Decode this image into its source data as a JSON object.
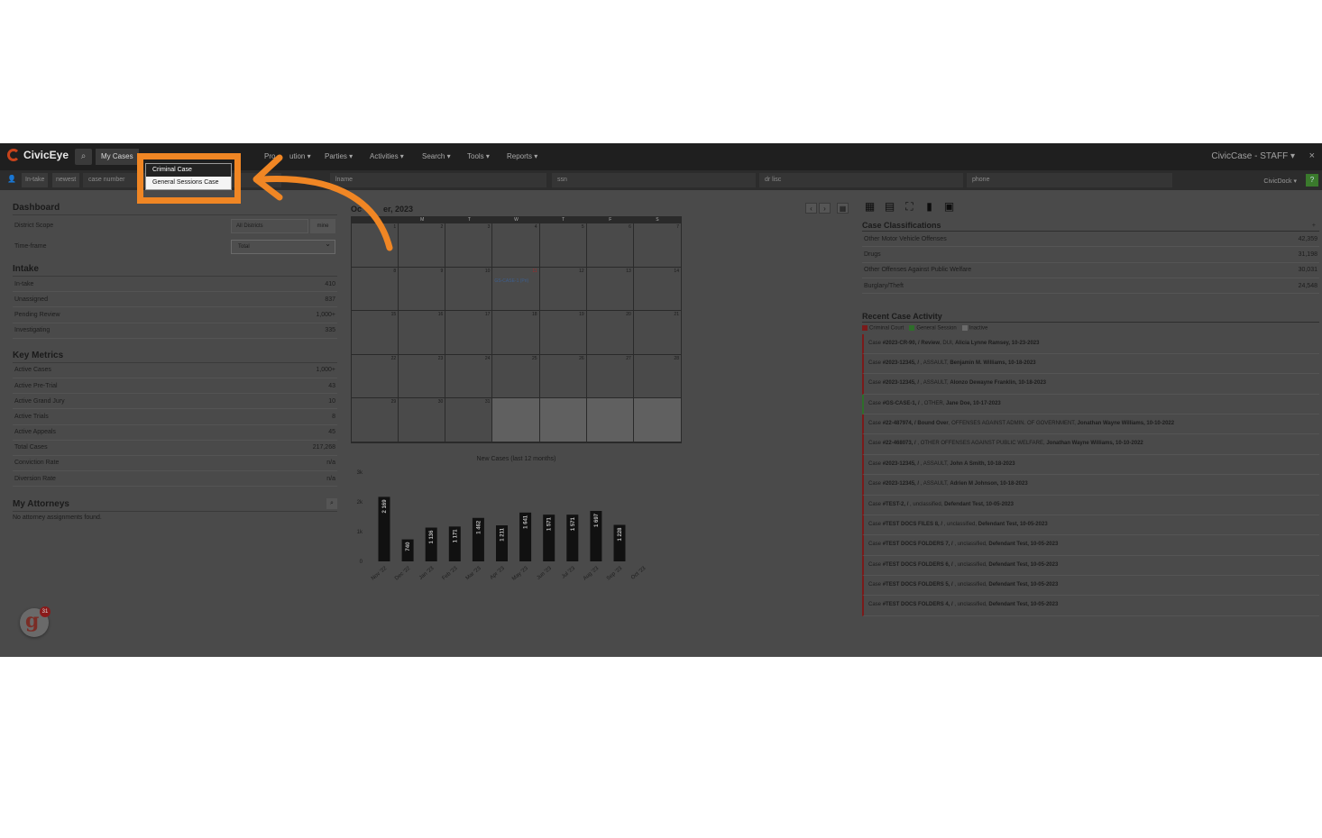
{
  "app": {
    "name": "CivicEye",
    "brand_right": "CivicCase - STAFF",
    "close": "×"
  },
  "nav": {
    "search_icon": "search-icon",
    "my_cases": "My Cases",
    "prosecution_visible": "Pro",
    "prosecution_tail": "ution",
    "items": [
      "Parties",
      "Activities",
      "Search",
      "Tools",
      "Reports"
    ]
  },
  "subbar": {
    "intake": "In-take",
    "newest": "newest",
    "case_number_ph": "case number",
    "lname_ph": "lname",
    "ssn_ph": "ssn",
    "dl_ph": "dr lisc",
    "phone_ph": "phone",
    "civicdock": "CivicDock",
    "green_btn": "?"
  },
  "dropdown": {
    "items": [
      "Criminal Case",
      "General Sessions Case"
    ]
  },
  "dashboard": {
    "title": "Dashboard",
    "district_label": "District Scope",
    "district_value": "All Districts",
    "mine": "mine",
    "timeframe_label": "Time-frame",
    "timeframe_value": "Total"
  },
  "intake": {
    "title": "Intake",
    "rows": [
      {
        "label": "In-take",
        "value": "410"
      },
      {
        "label": "Unassigned",
        "value": "837"
      },
      {
        "label": "Pending Review",
        "value": "1,000+"
      },
      {
        "label": "Investigating",
        "value": "335"
      }
    ]
  },
  "metrics": {
    "title": "Key Metrics",
    "rows": [
      {
        "label": "Active Cases",
        "value": "1,000+"
      },
      {
        "label": "Active Pre-Trial",
        "value": "43"
      },
      {
        "label": "Active Grand Jury",
        "value": "10"
      },
      {
        "label": "Active Trials",
        "value": "8"
      },
      {
        "label": "Active Appeals",
        "value": "45"
      },
      {
        "label": "Total Cases",
        "value": "217,268"
      },
      {
        "label": "Conviction Rate",
        "value": "n/a"
      },
      {
        "label": "Diversion Rate",
        "value": "n/a"
      }
    ]
  },
  "attorneys": {
    "title": "My Attorneys",
    "empty": "No attorney assignments found."
  },
  "calendar": {
    "title_start": "Oc",
    "title_end": "er, 2023",
    "days": [
      "S",
      "M",
      "T",
      "W",
      "T",
      "F",
      "S"
    ],
    "event": "GS-CASE-1 (Pri)",
    "prev": "‹",
    "next": "›",
    "cal_icon": "▦"
  },
  "chart_data": {
    "type": "bar",
    "title": "New Cases (last 12 months)",
    "categories": [
      "Nov '22",
      "Dec '22",
      "Jan '23",
      "Feb '23",
      "Mar '23",
      "Apr '23",
      "May '23",
      "Jun '23",
      "Jul '23",
      "Aug '23",
      "Sep '23",
      "Oct '23"
    ],
    "values": [
      2169,
      740,
      1136,
      1171,
      1462,
      1211,
      1641,
      1571,
      1571,
      1697,
      1228,
      0
    ],
    "value_labels": [
      "2 169",
      "740",
      "1 136",
      "1 171",
      "1 462",
      "1 211",
      "1 641",
      "1 571",
      "1 571",
      "1 697",
      "1 228",
      ""
    ],
    "yticks": [
      "0",
      "1k",
      "2k",
      "3k"
    ],
    "ylim": [
      0,
      3000
    ],
    "grid": false
  },
  "right": {
    "tool_icons": [
      "calculator-icon",
      "calendar-icon",
      "org-chart-icon",
      "document-icon",
      "book-icon"
    ],
    "classifications_title": "Case Classifications",
    "plus": "+",
    "classifications": [
      {
        "label": "Other Motor Vehicle Offenses",
        "value": "42,359"
      },
      {
        "label": "Drugs",
        "value": "31,198"
      },
      {
        "label": "Other Offenses Against Public Welfare",
        "value": "30,031"
      },
      {
        "label": "Burglary/Theft",
        "value": "24,548"
      }
    ],
    "activity_title": "Recent Case Activity",
    "legend": [
      {
        "label": "Criminal Court",
        "color": "#7a1a1a"
      },
      {
        "label": "General Session",
        "color": "#2e6e2a"
      },
      {
        "label": "Inactive",
        "color": "#6a6a6a"
      }
    ],
    "activity": [
      {
        "pre": "Case ",
        "bold": "#2023-CR-90, / Review",
        "mid": ", DUI, ",
        "name": "Alicia Lynne Ramsey, 10-23-2023",
        "type": "cc"
      },
      {
        "pre": "Case ",
        "bold": "#2023-12345, /",
        "mid": " , ASSAULT, ",
        "name": "Benjamin M. Williams, 10-18-2023",
        "type": "cc"
      },
      {
        "pre": "Case ",
        "bold": "#2023-12345, /",
        "mid": " , ASSAULT, ",
        "name": "Alonzo Dewayne Franklin, 10-18-2023",
        "type": "cc"
      },
      {
        "pre": "Case ",
        "bold": "#GS-CASE-1, /",
        "mid": " , OTHER, ",
        "name": "Jane Doe, 10-17-2023",
        "type": "gs"
      },
      {
        "pre": "Case ",
        "bold": "#22-487974, / Bound Over",
        "mid": ", OFFENSES AGAINST ADMIN. OF GOVERNMENT, ",
        "name": "Jonathan Wayne Williams, 10-10-2022",
        "type": "cc"
      },
      {
        "pre": "Case ",
        "bold": "#22-468073, /",
        "mid": " , OTHER OFFENSES AGAINST PUBLIC WELFARE, ",
        "name": "Jonathan Wayne Williams, 10-10-2022",
        "type": "cc"
      },
      {
        "pre": "Case ",
        "bold": "#2023-12345, /",
        "mid": " , ASSAULT, ",
        "name": "John A Smith, 10-18-2023",
        "type": "cc"
      },
      {
        "pre": "Case ",
        "bold": "#2023-12345, /",
        "mid": " , ASSAULT, ",
        "name": "Adrien M Johnson, 10-18-2023",
        "type": "cc"
      },
      {
        "pre": "Case ",
        "bold": "#TEST-2, /",
        "mid": " , unclassified, ",
        "name": "Defendant Test, 10-05-2023",
        "type": "cc"
      },
      {
        "pre": "Case ",
        "bold": "#TEST DOCS FILES 8, /",
        "mid": " , unclassified, ",
        "name": "Defendant Test, 10-05-2023",
        "type": "cc"
      },
      {
        "pre": "Case ",
        "bold": "#TEST DOCS FOLDERS 7, /",
        "mid": " , unclassified, ",
        "name": "Defendant Test, 10-05-2023",
        "type": "cc"
      },
      {
        "pre": "Case ",
        "bold": "#TEST DOCS FOLDERS 6, /",
        "mid": " , unclassified, ",
        "name": "Defendant Test, 10-05-2023",
        "type": "cc"
      },
      {
        "pre": "Case ",
        "bold": "#TEST DOCS FOLDERS 5, /",
        "mid": " , unclassified, ",
        "name": "Defendant Test, 10-05-2023",
        "type": "cc"
      },
      {
        "pre": "Case ",
        "bold": "#TEST DOCS FOLDERS 4, /",
        "mid": " , unclassified, ",
        "name": "Defendant Test, 10-05-2023",
        "type": "cc"
      }
    ]
  },
  "badge": {
    "letter": "g",
    "count": "31"
  }
}
